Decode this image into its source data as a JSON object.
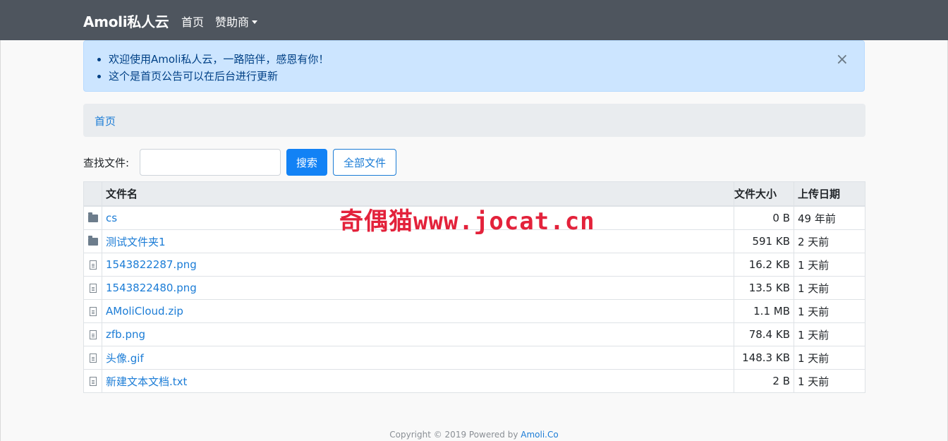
{
  "navbar": {
    "brand": "Amoli私人云",
    "home": "首页",
    "sponsor": "赞助商"
  },
  "alert": {
    "items": [
      "欢迎使用Amoli私人云，一路陪伴，感恩有你！",
      "这个是首页公告可以在后台进行更新"
    ],
    "close": "×"
  },
  "breadcrumb": {
    "home": "首页"
  },
  "search": {
    "label": "查找文件:",
    "placeholder": "",
    "value": "",
    "button": "搜索",
    "all_files": "全部文件"
  },
  "table": {
    "headers": {
      "name": "文件名",
      "size": "文件大小",
      "date": "上传日期"
    },
    "rows": [
      {
        "icon": "folder-icon",
        "name": "cs",
        "size": "0 B",
        "date": "49 年前"
      },
      {
        "icon": "folder-icon",
        "name": "测试文件夹1",
        "size": "591 KB",
        "date": "2 天前"
      },
      {
        "icon": "file-icon",
        "name": "1543822287.png",
        "size": "16.2 KB",
        "date": "1 天前"
      },
      {
        "icon": "file-icon",
        "name": "1543822480.png",
        "size": "13.5 KB",
        "date": "1 天前"
      },
      {
        "icon": "file-icon",
        "name": "AMoliCloud.zip",
        "size": "1.1 MB",
        "date": "1 天前"
      },
      {
        "icon": "file-icon",
        "name": "zfb.png",
        "size": "78.4 KB",
        "date": "1 天前"
      },
      {
        "icon": "file-icon",
        "name": "头像.gif",
        "size": "148.3 KB",
        "date": "1 天前"
      },
      {
        "icon": "file-icon",
        "name": "新建文本文档.txt",
        "size": "2 B",
        "date": "1 天前"
      }
    ]
  },
  "watermark": "奇偶猫www.jocat.cn",
  "footer": {
    "text": "Copyright © 2019 Powered by ",
    "link": "Amoli.Co"
  },
  "colors": {
    "navbar": "#4e555e",
    "link": "#1b7cd6",
    "primary": "#1282f5",
    "alert_bg": "#cce5ff",
    "watermark": "#e3223b"
  }
}
